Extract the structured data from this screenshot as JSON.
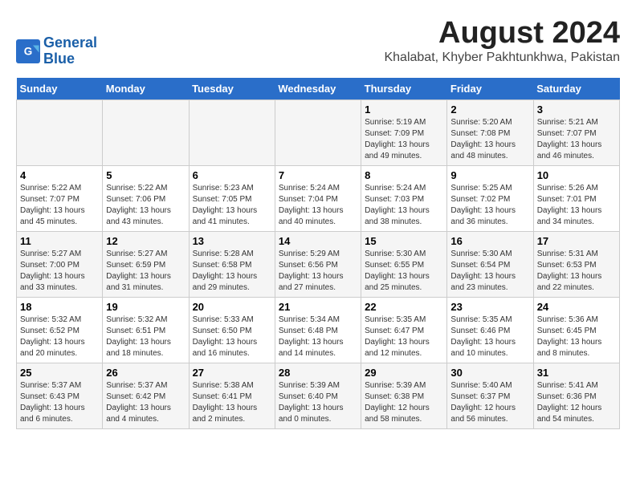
{
  "logo": {
    "line1": "General",
    "line2": "Blue"
  },
  "title": "August 2024",
  "location": "Khalabat, Khyber Pakhtunkhwa, Pakistan",
  "days_of_week": [
    "Sunday",
    "Monday",
    "Tuesday",
    "Wednesday",
    "Thursday",
    "Friday",
    "Saturday"
  ],
  "weeks": [
    [
      {
        "day": "",
        "sunrise": "",
        "sunset": "",
        "daylight": ""
      },
      {
        "day": "",
        "sunrise": "",
        "sunset": "",
        "daylight": ""
      },
      {
        "day": "",
        "sunrise": "",
        "sunset": "",
        "daylight": ""
      },
      {
        "day": "",
        "sunrise": "",
        "sunset": "",
        "daylight": ""
      },
      {
        "day": "1",
        "sunrise": "Sunrise: 5:19 AM",
        "sunset": "Sunset: 7:09 PM",
        "daylight": "Daylight: 13 hours and 49 minutes."
      },
      {
        "day": "2",
        "sunrise": "Sunrise: 5:20 AM",
        "sunset": "Sunset: 7:08 PM",
        "daylight": "Daylight: 13 hours and 48 minutes."
      },
      {
        "day": "3",
        "sunrise": "Sunrise: 5:21 AM",
        "sunset": "Sunset: 7:07 PM",
        "daylight": "Daylight: 13 hours and 46 minutes."
      }
    ],
    [
      {
        "day": "4",
        "sunrise": "Sunrise: 5:22 AM",
        "sunset": "Sunset: 7:07 PM",
        "daylight": "Daylight: 13 hours and 45 minutes."
      },
      {
        "day": "5",
        "sunrise": "Sunrise: 5:22 AM",
        "sunset": "Sunset: 7:06 PM",
        "daylight": "Daylight: 13 hours and 43 minutes."
      },
      {
        "day": "6",
        "sunrise": "Sunrise: 5:23 AM",
        "sunset": "Sunset: 7:05 PM",
        "daylight": "Daylight: 13 hours and 41 minutes."
      },
      {
        "day": "7",
        "sunrise": "Sunrise: 5:24 AM",
        "sunset": "Sunset: 7:04 PM",
        "daylight": "Daylight: 13 hours and 40 minutes."
      },
      {
        "day": "8",
        "sunrise": "Sunrise: 5:24 AM",
        "sunset": "Sunset: 7:03 PM",
        "daylight": "Daylight: 13 hours and 38 minutes."
      },
      {
        "day": "9",
        "sunrise": "Sunrise: 5:25 AM",
        "sunset": "Sunset: 7:02 PM",
        "daylight": "Daylight: 13 hours and 36 minutes."
      },
      {
        "day": "10",
        "sunrise": "Sunrise: 5:26 AM",
        "sunset": "Sunset: 7:01 PM",
        "daylight": "Daylight: 13 hours and 34 minutes."
      }
    ],
    [
      {
        "day": "11",
        "sunrise": "Sunrise: 5:27 AM",
        "sunset": "Sunset: 7:00 PM",
        "daylight": "Daylight: 13 hours and 33 minutes."
      },
      {
        "day": "12",
        "sunrise": "Sunrise: 5:27 AM",
        "sunset": "Sunset: 6:59 PM",
        "daylight": "Daylight: 13 hours and 31 minutes."
      },
      {
        "day": "13",
        "sunrise": "Sunrise: 5:28 AM",
        "sunset": "Sunset: 6:58 PM",
        "daylight": "Daylight: 13 hours and 29 minutes."
      },
      {
        "day": "14",
        "sunrise": "Sunrise: 5:29 AM",
        "sunset": "Sunset: 6:56 PM",
        "daylight": "Daylight: 13 hours and 27 minutes."
      },
      {
        "day": "15",
        "sunrise": "Sunrise: 5:30 AM",
        "sunset": "Sunset: 6:55 PM",
        "daylight": "Daylight: 13 hours and 25 minutes."
      },
      {
        "day": "16",
        "sunrise": "Sunrise: 5:30 AM",
        "sunset": "Sunset: 6:54 PM",
        "daylight": "Daylight: 13 hours and 23 minutes."
      },
      {
        "day": "17",
        "sunrise": "Sunrise: 5:31 AM",
        "sunset": "Sunset: 6:53 PM",
        "daylight": "Daylight: 13 hours and 22 minutes."
      }
    ],
    [
      {
        "day": "18",
        "sunrise": "Sunrise: 5:32 AM",
        "sunset": "Sunset: 6:52 PM",
        "daylight": "Daylight: 13 hours and 20 minutes."
      },
      {
        "day": "19",
        "sunrise": "Sunrise: 5:32 AM",
        "sunset": "Sunset: 6:51 PM",
        "daylight": "Daylight: 13 hours and 18 minutes."
      },
      {
        "day": "20",
        "sunrise": "Sunrise: 5:33 AM",
        "sunset": "Sunset: 6:50 PM",
        "daylight": "Daylight: 13 hours and 16 minutes."
      },
      {
        "day": "21",
        "sunrise": "Sunrise: 5:34 AM",
        "sunset": "Sunset: 6:48 PM",
        "daylight": "Daylight: 13 hours and 14 minutes."
      },
      {
        "day": "22",
        "sunrise": "Sunrise: 5:35 AM",
        "sunset": "Sunset: 6:47 PM",
        "daylight": "Daylight: 13 hours and 12 minutes."
      },
      {
        "day": "23",
        "sunrise": "Sunrise: 5:35 AM",
        "sunset": "Sunset: 6:46 PM",
        "daylight": "Daylight: 13 hours and 10 minutes."
      },
      {
        "day": "24",
        "sunrise": "Sunrise: 5:36 AM",
        "sunset": "Sunset: 6:45 PM",
        "daylight": "Daylight: 13 hours and 8 minutes."
      }
    ],
    [
      {
        "day": "25",
        "sunrise": "Sunrise: 5:37 AM",
        "sunset": "Sunset: 6:43 PM",
        "daylight": "Daylight: 13 hours and 6 minutes."
      },
      {
        "day": "26",
        "sunrise": "Sunrise: 5:37 AM",
        "sunset": "Sunset: 6:42 PM",
        "daylight": "Daylight: 13 hours and 4 minutes."
      },
      {
        "day": "27",
        "sunrise": "Sunrise: 5:38 AM",
        "sunset": "Sunset: 6:41 PM",
        "daylight": "Daylight: 13 hours and 2 minutes."
      },
      {
        "day": "28",
        "sunrise": "Sunrise: 5:39 AM",
        "sunset": "Sunset: 6:40 PM",
        "daylight": "Daylight: 13 hours and 0 minutes."
      },
      {
        "day": "29",
        "sunrise": "Sunrise: 5:39 AM",
        "sunset": "Sunset: 6:38 PM",
        "daylight": "Daylight: 12 hours and 58 minutes."
      },
      {
        "day": "30",
        "sunrise": "Sunrise: 5:40 AM",
        "sunset": "Sunset: 6:37 PM",
        "daylight": "Daylight: 12 hours and 56 minutes."
      },
      {
        "day": "31",
        "sunrise": "Sunrise: 5:41 AM",
        "sunset": "Sunset: 6:36 PM",
        "daylight": "Daylight: 12 hours and 54 minutes."
      }
    ]
  ]
}
